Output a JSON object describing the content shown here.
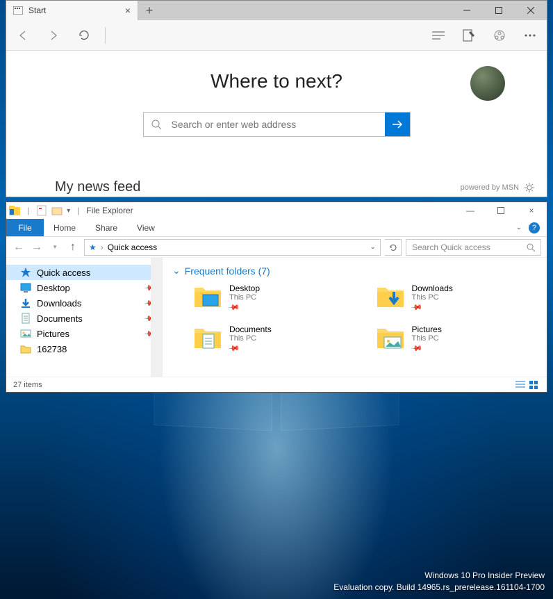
{
  "edge": {
    "tab_title": "Start",
    "hero": "Where to next?",
    "search_placeholder": "Search or enter web address",
    "feed_label": "My news feed",
    "powered": "powered by MSN"
  },
  "explorer": {
    "title": "File Explorer",
    "file_tab": "File",
    "tabs": [
      "Home",
      "Share",
      "View"
    ],
    "breadcrumb": "Quick access",
    "search_placeholder": "Search Quick access",
    "section_header": "Frequent folders (7)",
    "nav": [
      {
        "label": "Quick access",
        "icon": "star",
        "selected": true,
        "pinned": false
      },
      {
        "label": "Desktop",
        "icon": "desktop",
        "selected": false,
        "pinned": true
      },
      {
        "label": "Downloads",
        "icon": "download",
        "selected": false,
        "pinned": true
      },
      {
        "label": "Documents",
        "icon": "document",
        "selected": false,
        "pinned": true
      },
      {
        "label": "Pictures",
        "icon": "picture",
        "selected": false,
        "pinned": true
      },
      {
        "label": "162738",
        "icon": "folder",
        "selected": false,
        "pinned": false
      }
    ],
    "folders": [
      {
        "name": "Desktop",
        "sub": "This PC",
        "overlay": "desktop"
      },
      {
        "name": "Downloads",
        "sub": "This PC",
        "overlay": "download"
      },
      {
        "name": "Documents",
        "sub": "This PC",
        "overlay": "document"
      },
      {
        "name": "Pictures",
        "sub": "This PC",
        "overlay": "picture"
      }
    ],
    "status": "27 items"
  },
  "watermark": {
    "line1": "Windows 10 Pro Insider Preview",
    "line2": "Evaluation copy. Build 14965.rs_prerelease.161104-1700"
  }
}
